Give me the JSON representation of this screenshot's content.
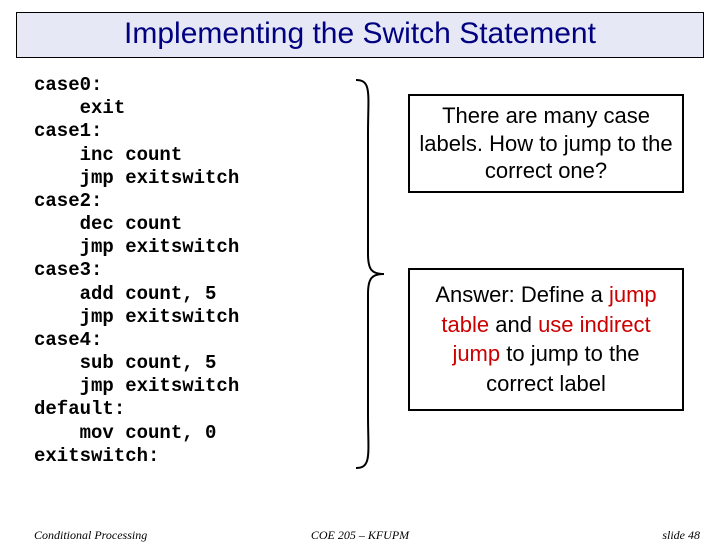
{
  "title": "Implementing the Switch Statement",
  "code_lines": [
    "case0:",
    "    exit",
    "case1:",
    "    inc count",
    "    jmp exitswitch",
    "case2:",
    "    dec count",
    "    jmp exitswitch",
    "case3:",
    "    add count, 5",
    "    jmp exitswitch",
    "case4:",
    "    sub count, 5",
    "    jmp exitswitch",
    "default:",
    "    mov count, 0",
    "exitswitch:"
  ],
  "question": "There are many case labels. How to jump to the correct one?",
  "answer": {
    "pre": "Answer: Define a ",
    "s1": "jump table",
    "mid1": " and ",
    "s2": "use indirect jump",
    "mid2": " to jump to the correct label"
  },
  "footer": {
    "left": "Conditional Processing",
    "center": "COE 205 – KFUPM",
    "right": "slide 48"
  }
}
